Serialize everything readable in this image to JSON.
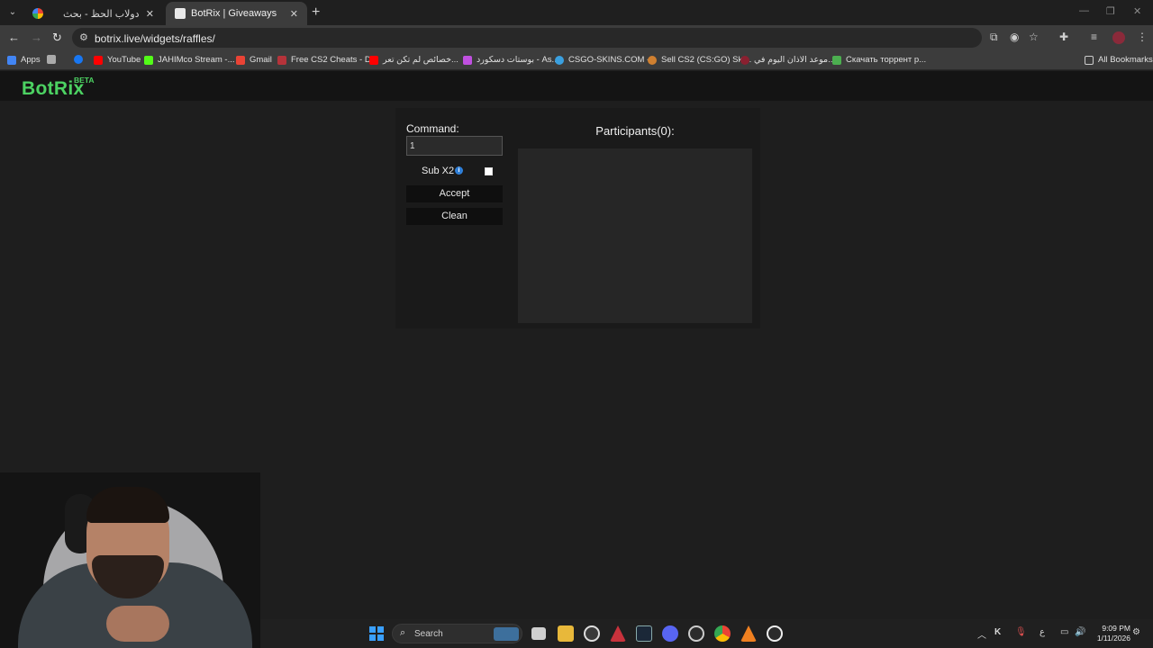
{
  "browser": {
    "tabs": [
      {
        "title": "دولاب الحظ - بحث Google",
        "active": false
      },
      {
        "title": "BotRix | Giveaways",
        "active": true
      }
    ],
    "new_tab": "+",
    "address": "botrix.live/widgets/raffles/",
    "bookmarks": [
      {
        "label": "Apps",
        "color": "#4285f4"
      },
      {
        "label": "",
        "color": "#aaaaaa"
      },
      {
        "label": "",
        "color": "#1877f2"
      },
      {
        "label": "YouTube",
        "color": "#ff0000"
      },
      {
        "label": "JAHIMco Stream -...",
        "color": "#53fc18"
      },
      {
        "label": "Gmail",
        "color": "#ea4335"
      },
      {
        "label": "Free CS2 Cheats - D...",
        "color": "#b5333a"
      },
      {
        "label": "خصائص لم تكن تعر...",
        "color": "#ff0000"
      },
      {
        "label": "بوستات دسكورد - As...",
        "color": "#c050e0"
      },
      {
        "label": "CSGO-SKINS.COM -...",
        "color": "#3aa0e0"
      },
      {
        "label": "Sell CS2 (CS:GO) Ski...",
        "color": "#d08030"
      },
      {
        "label": "موعد الاذان اليوم في...",
        "color": "#8a2030"
      },
      {
        "label": "Скачать торрент р...",
        "color": "#4caf50"
      }
    ],
    "all_bookmarks": "All Bookmarks"
  },
  "site": {
    "logo": "BotRix",
    "logo_badge": "BETA",
    "accent_color": "#4cd262"
  },
  "raffle": {
    "command_label": "Command:",
    "command_value": "1",
    "sub_label": "Sub X2",
    "sub_checked": false,
    "accept_label": "Accept",
    "clean_label": "Clean",
    "participants_label": "Participants(0):"
  },
  "taskbar": {
    "search_label": "Search",
    "time": "9:09 PM",
    "date": "1/11/2026",
    "lang": "ع"
  }
}
